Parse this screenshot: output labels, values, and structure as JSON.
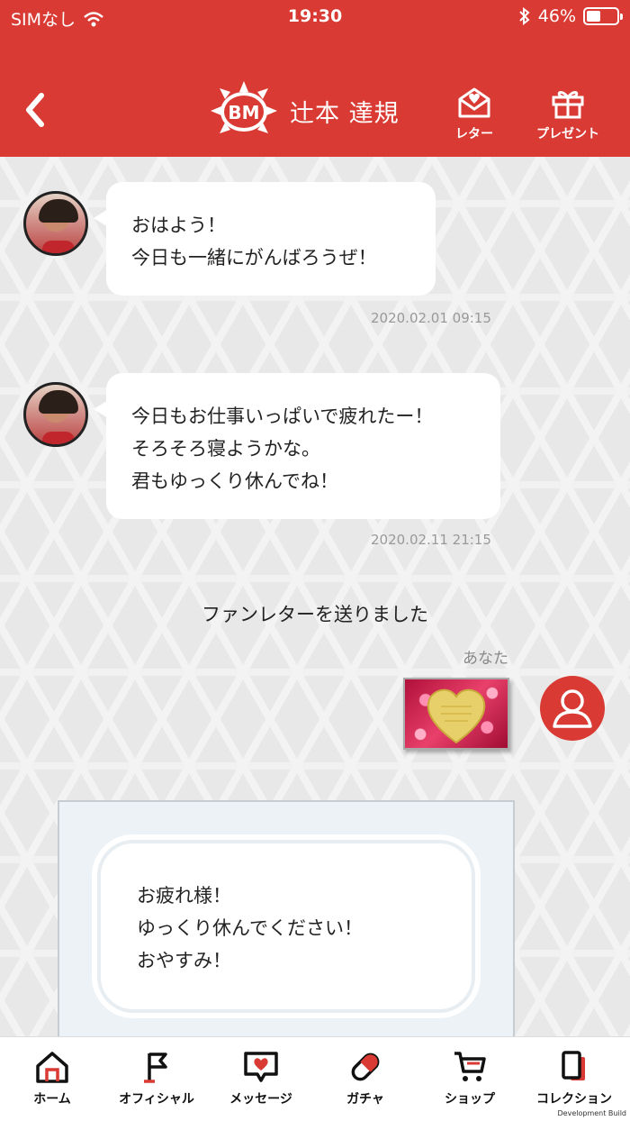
{
  "status_bar": {
    "carrier": "SIMなし",
    "time": "19:30",
    "battery": "46%",
    "battery_level": 0.46
  },
  "header": {
    "back_icon": "chevron-left-icon",
    "logo_text": "BM",
    "title": "辻本 達規",
    "letter_label": "レター",
    "present_label": "プレゼント"
  },
  "messages": [
    {
      "lines": [
        "おはよう！",
        "今日も一緒にがんばろうぜ！"
      ],
      "timestamp": "2020.02.01 09:15"
    },
    {
      "lines": [
        "今日もお仕事いっぱいで疲れたー！",
        "そろそろ寝ようかな。",
        "君もゆっくり休んでね！"
      ],
      "timestamp": "2020.02.11 21:15"
    }
  ],
  "notice": "ファンレターを送りました",
  "you_label": "あなた",
  "letter": {
    "lines": [
      "お疲れ様！",
      "ゆっくり休んでください！",
      "おやすみ！"
    ]
  },
  "tabs": [
    {
      "label": "ホーム",
      "icon": "home-icon"
    },
    {
      "label": "オフィシャル",
      "icon": "flag-icon"
    },
    {
      "label": "メッセージ",
      "icon": "message-heart-icon"
    },
    {
      "label": "ガチャ",
      "icon": "capsule-icon"
    },
    {
      "label": "ショップ",
      "icon": "cart-icon"
    },
    {
      "label": "コレクション",
      "icon": "cards-icon"
    }
  ],
  "dev_note": "Development Build",
  "colors": {
    "brand": "#d93a33",
    "background": "#e8e8e8"
  }
}
